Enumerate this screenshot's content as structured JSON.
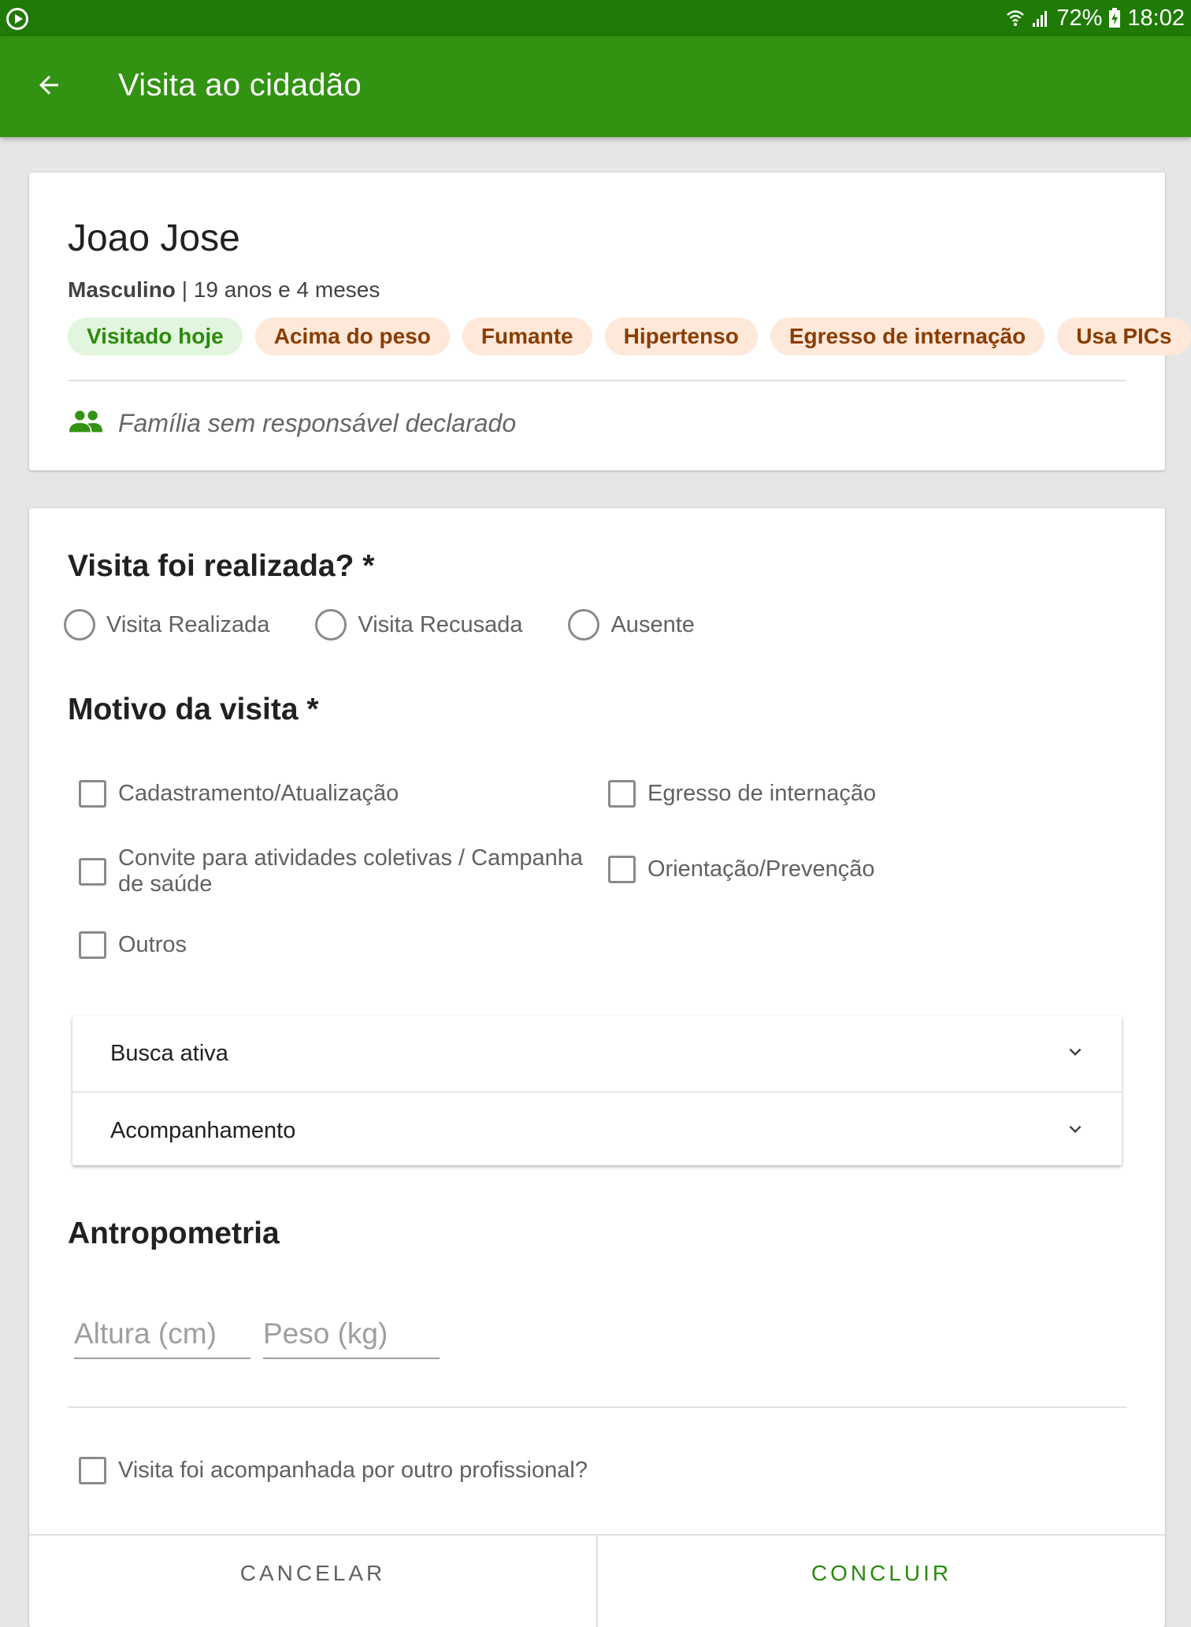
{
  "status_bar": {
    "battery": "72%",
    "time": "18:02",
    "icons": [
      "screen-cast-icon",
      "wifi-icon",
      "signal-icon",
      "battery-charging-icon"
    ]
  },
  "app_bar": {
    "title": "Visita ao cidadão",
    "back_icon": "arrow-back-icon"
  },
  "citizen": {
    "name": "Joao Jose",
    "sex": "Masculino",
    "separator": " | ",
    "age": "19 anos e 4 meses",
    "tags": [
      {
        "label": "Visitado hoje",
        "color": "#2a8a0c"
      },
      {
        "label": "Acima do peso",
        "color": "#8a3d00"
      },
      {
        "label": "Fumante",
        "color": "#8a3d00"
      },
      {
        "label": "Hipertenso",
        "color": "#8a3d00"
      },
      {
        "label": "Egresso de internação",
        "color": "#8a3d00"
      },
      {
        "label": "Usa PICs",
        "color": "#8a3d00"
      }
    ],
    "family_text": "Família sem responsável declarado",
    "family_icon": "people-icon"
  },
  "form": {
    "visit_done_title": "Visita foi realizada? *",
    "visit_done_options": [
      "Visita Realizada",
      "Visita Recusada",
      "Ausente"
    ],
    "reason_title": "Motivo da visita *",
    "reason_options": {
      "registration": "Cadastramento/Atualização",
      "discharge": "Egresso de internação",
      "invitation": "Convite para atividades coletivas / Campanha de saúde",
      "guidance": "Orientação/Prevenção",
      "others": "Outros"
    },
    "accordion": [
      "Busca ativa",
      "Acompanhamento"
    ],
    "anthropometry_title": "Antropometria",
    "height_placeholder": "Altura (cm)",
    "weight_placeholder": "Peso (kg)",
    "accompanied_label": "Visita foi acompanhada por outro profissional?"
  },
  "footer": {
    "cancel": "CANCELAR",
    "conclude": "CONCLUIR"
  },
  "colors": {
    "status_bar": "#1f7a06",
    "app_bar": "#329211",
    "accent": "#2a8a0c",
    "tag_bg": "#fde8da",
    "tag_green_bg": "#e2f5de"
  }
}
